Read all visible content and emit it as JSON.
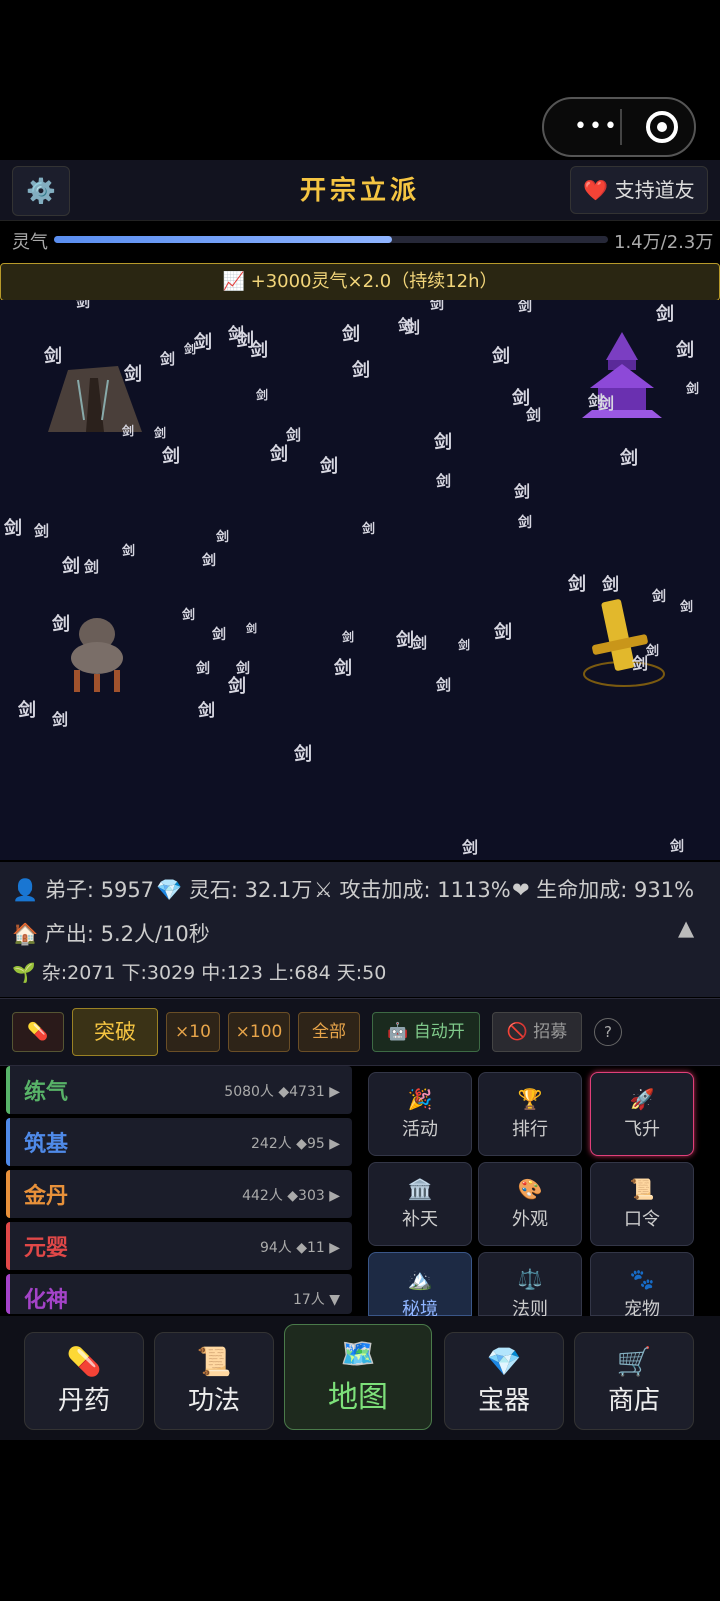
{
  "capsule": {
    "more_icon": "more-dots-icon",
    "close_icon": "target-circle-icon"
  },
  "header": {
    "settings_icon": "⚙️",
    "title": "开宗立派",
    "support_icon": "❤️",
    "support_label": "支持道友"
  },
  "lingqi": {
    "label": "灵气",
    "value": "1.4万/2.3万",
    "progress": 0.61
  },
  "buff": {
    "icon": "📈",
    "text": "+3000灵气×2.0（持续12h）"
  },
  "map": {
    "sword_glyph": "剑"
  },
  "stats": {
    "disciples_icon": "👤",
    "disciples": "弟子: 5957",
    "stones_icon": "💎",
    "stones": "灵石: 32.1万",
    "attack_icon": "⚔",
    "attack": "攻击加成: 1113%",
    "life_icon": "❤",
    "life": "生命加成: 931%",
    "output_icon": "🏠",
    "output": "产出: 5.2人/10秒",
    "collapse_icon": "▲",
    "grades_icon": "🌱",
    "grades": "杂:2071 下:3029 中:123 上:684 天:50"
  },
  "actions": {
    "pill_icon": "💊",
    "breakthrough": "突破",
    "x10": "×10",
    "x100": "×100",
    "all": "全部",
    "auto_icon": "🤖",
    "auto": "自动开",
    "recruit_icon": "🚫",
    "recruit": "招募",
    "help": "?"
  },
  "realms": [
    {
      "name": "练气",
      "info": "5080人 ◆4731",
      "arrow": "▶",
      "color": "#58b368"
    },
    {
      "name": "筑基",
      "info": "242人 ◆95",
      "arrow": "▶",
      "color": "#4f8ae8"
    },
    {
      "name": "金丹",
      "info": "442人 ◆303",
      "arrow": "▶",
      "color": "#e8913a"
    },
    {
      "name": "元婴",
      "info": "94人 ◆11",
      "arrow": "▶",
      "color": "#e04848"
    },
    {
      "name": "化神",
      "info": "17人",
      "arrow": "▼",
      "color": "#a443c8"
    }
  ],
  "grid": [
    {
      "icon": "🎉",
      "label": "活动"
    },
    {
      "icon": "🏆",
      "label": "排行"
    },
    {
      "icon": "🚀",
      "label": "飞升"
    },
    {
      "icon": "🏛️",
      "label": "补天"
    },
    {
      "icon": "🎨",
      "label": "外观"
    },
    {
      "icon": "📜",
      "label": "口令"
    },
    {
      "icon": "🏔️",
      "label": "秘境"
    },
    {
      "icon": "⚖️",
      "label": "法则"
    },
    {
      "icon": "🐾",
      "label": "宠物"
    }
  ],
  "nav": [
    {
      "icon": "💊",
      "label": "丹药"
    },
    {
      "icon": "📜",
      "label": "功法"
    },
    {
      "icon": "🗺️",
      "label": "地图"
    },
    {
      "icon": "💎",
      "label": "宝器"
    },
    {
      "icon": "🛒",
      "label": "商店"
    }
  ],
  "colors": {
    "accent_gold": "#f5c542",
    "map_bg": "#0d0f23",
    "active_nav": "#7de07a"
  }
}
